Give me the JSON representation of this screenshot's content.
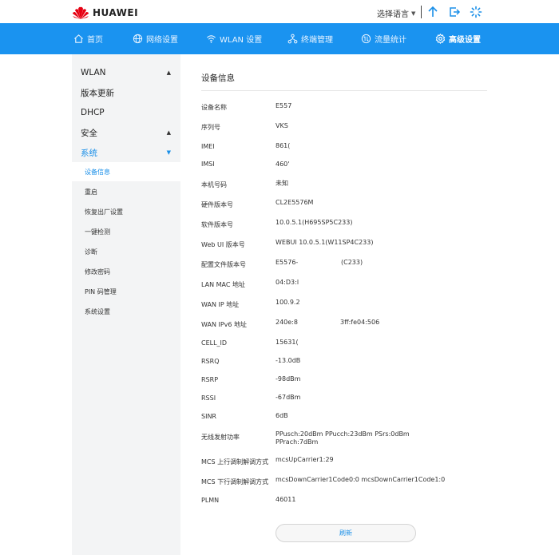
{
  "header": {
    "brand": "HUAWEI",
    "language_label": "选择语言",
    "icons": [
      "upload-icon",
      "logout-icon",
      "loading-icon"
    ]
  },
  "nav": {
    "items": [
      {
        "label": "首页",
        "icon": "home-icon"
      },
      {
        "label": "网络设置",
        "icon": "globe-icon"
      },
      {
        "label": "WLAN 设置",
        "icon": "wifi-icon"
      },
      {
        "label": "终端管理",
        "icon": "devices-icon"
      },
      {
        "label": "流量统计",
        "icon": "traffic-icon"
      },
      {
        "label": "高级设置",
        "icon": "gear-icon",
        "active": true
      }
    ]
  },
  "sidebar": {
    "sections": [
      {
        "label": "WLAN",
        "expandable": true
      },
      {
        "label": "版本更新"
      },
      {
        "label": "DHCP"
      },
      {
        "label": "安全",
        "expandable": true
      },
      {
        "label": "系统",
        "expandable": true,
        "open": true
      }
    ],
    "subitems": [
      {
        "label": "设备信息",
        "active": true
      },
      {
        "label": "重启"
      },
      {
        "label": "恢复出厂设置"
      },
      {
        "label": "一键检测"
      },
      {
        "label": "诊断"
      },
      {
        "label": "修改密码"
      },
      {
        "label": "PIN 码管理"
      },
      {
        "label": "系统设置"
      }
    ]
  },
  "main": {
    "title": "设备信息",
    "rows": [
      {
        "label": "设备名称",
        "value": "E557"
      },
      {
        "label": "序列号",
        "value": "VKS"
      },
      {
        "label": "IMEI",
        "value": "861("
      },
      {
        "label": "IMSI",
        "value": "460'"
      },
      {
        "label": "本机号码",
        "value": "未知"
      },
      {
        "label": "硬件版本号",
        "value": "CL2E5576M"
      },
      {
        "label": "软件版本号",
        "value": "10.0.5.1(H695SP5C233)"
      },
      {
        "label": "Web UI 版本号",
        "value": "WEBUI 10.0.5.1(W11SP4C233)"
      },
      {
        "label": "配置文件版本号",
        "value": "E5576-",
        "extra": "(C233)"
      },
      {
        "label": "LAN MAC 地址",
        "value": "04:D3:l"
      },
      {
        "label": "WAN IP 地址",
        "value": "100.9.2"
      },
      {
        "label": "WAN IPv6 地址",
        "value": "240e:8",
        "extra": "3ff:fe04:506"
      },
      {
        "label": "CELL_ID",
        "value": "15631("
      },
      {
        "label": "RSRQ",
        "value": "-13.0dB"
      },
      {
        "label": "RSRP",
        "value": "-98dBm"
      },
      {
        "label": "RSSI",
        "value": "-67dBm"
      },
      {
        "label": "SINR",
        "value": "6dB"
      },
      {
        "label": "无线发射功率",
        "value": "PPusch:20dBm PPucch:23dBm PSrs:0dBm PPrach:7dBm"
      },
      {
        "label": "MCS 上行调制解调方式",
        "value": "mcsUpCarrier1:29"
      },
      {
        "label": "MCS 下行调制解调方式",
        "value": "mcsDownCarrier1Code0:0 mcsDownCarrier1Code1:0"
      },
      {
        "label": "PLMN",
        "value": "46011"
      }
    ],
    "refresh_label": "刷新"
  },
  "colors": {
    "accent": "#1a93f0",
    "brand_red": "#e60012",
    "sidebar_bg": "#f3f4f5"
  }
}
